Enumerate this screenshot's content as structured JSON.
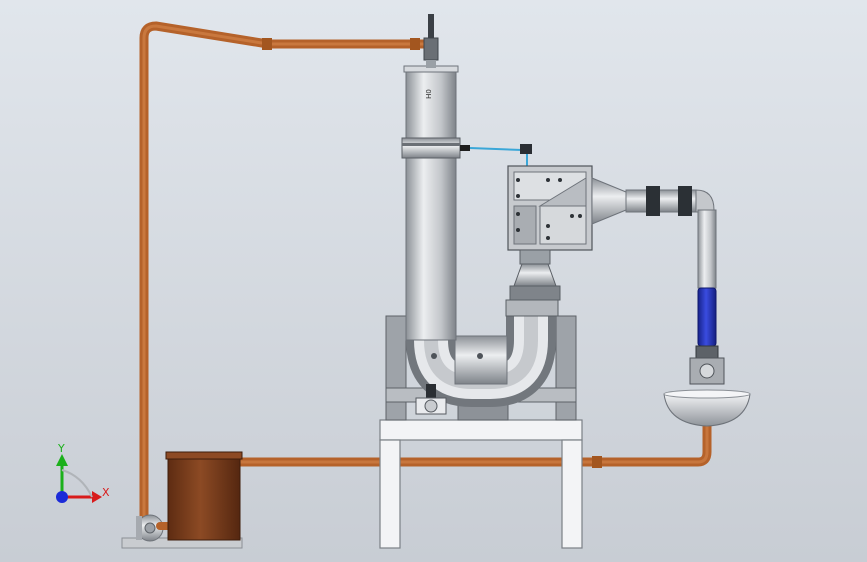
{
  "colors": {
    "background_top": "#dfe4ea",
    "background_bottom": "#c9ced5",
    "copper_pipe": "#b5622a",
    "tank": "#7a3d1c",
    "steel_light": "#e2e4e7",
    "steel_dark": "#8f949a",
    "hose_blue": "#2436b8",
    "signal_line": "#3aa7d8",
    "axis_x": "#d81b1b",
    "axis_y": "#1bb01b",
    "axis_z": "#1b2bd8"
  },
  "column_label": "H0",
  "triad": {
    "x_label": "X",
    "y_label": "Y"
  }
}
